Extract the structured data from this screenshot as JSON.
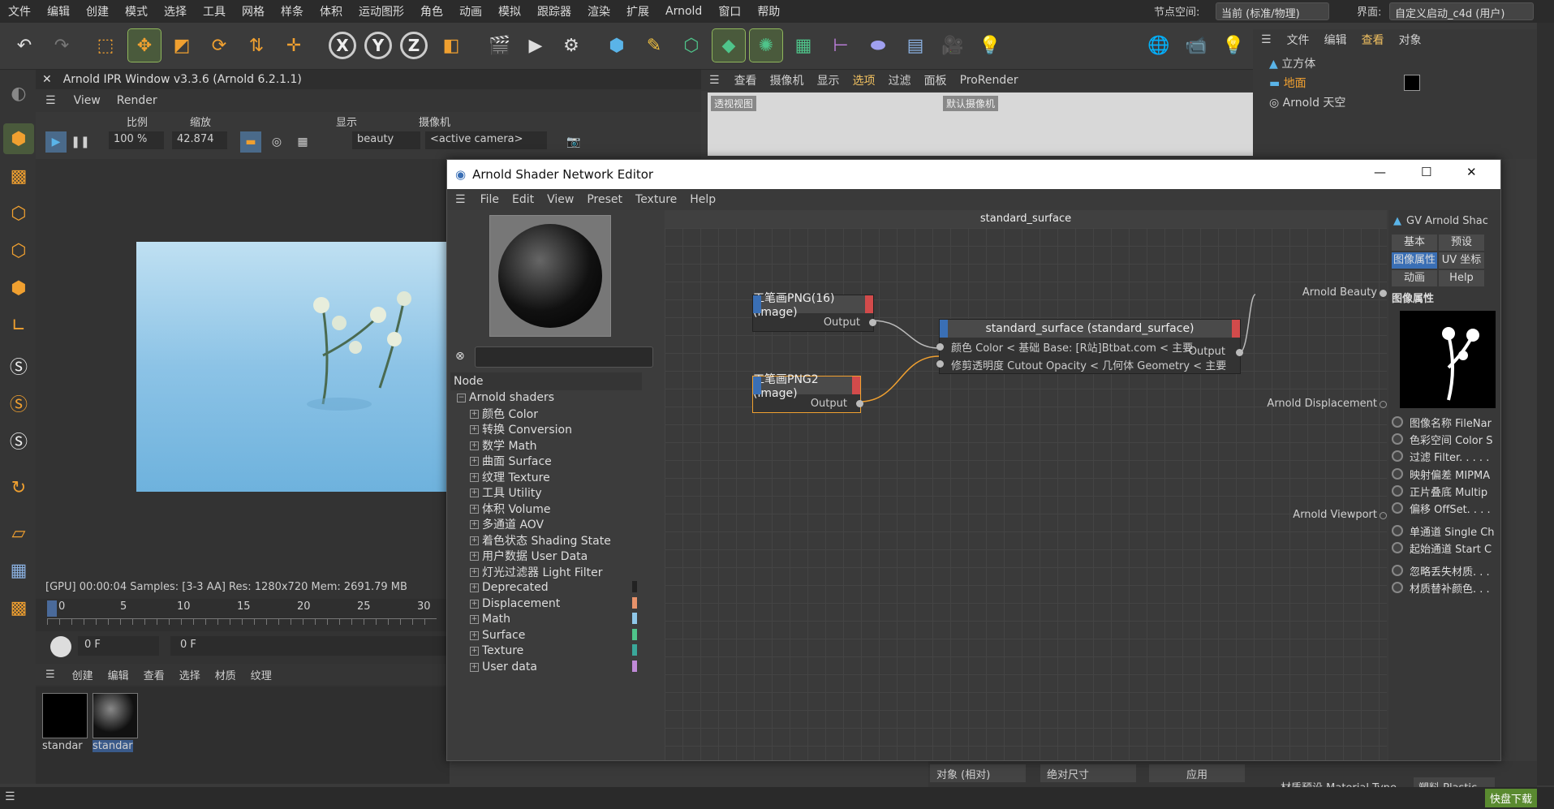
{
  "menubar": {
    "items": [
      "文件",
      "编辑",
      "创建",
      "模式",
      "选择",
      "工具",
      "网格",
      "样条",
      "体积",
      "运动图形",
      "角色",
      "动画",
      "模拟",
      "跟踪器",
      "渲染",
      "扩展",
      "Arnold",
      "窗口",
      "帮助"
    ],
    "node_space_label": "节点空间:",
    "node_space_value": "当前 (标准/物理)",
    "layout_label": "界面:",
    "layout_value": "自定义启动_c4d (用户)"
  },
  "toolbar": {
    "x": "X",
    "y": "Y",
    "z": "Z"
  },
  "ipr": {
    "title": "Arnold IPR Window v3.3.6 (Arnold 6.2.1.1)",
    "menu": [
      "View",
      "Render"
    ],
    "scale_label": "比例",
    "scale_value": "100 %",
    "zoom_label": "缩放",
    "zoom_value": "42.874",
    "display_label": "显示",
    "display_value": "beauty",
    "camera_label": "摄像机",
    "camera_value": "<active camera>",
    "status": "[GPU] 00:00:04  Samples: [3-3 AA]  Res: 1280x720  Mem: 2691.79 MB"
  },
  "timeline": {
    "ticks": [
      "0",
      "5",
      "10",
      "15",
      "20",
      "25",
      "30"
    ],
    "frame_a": "0 F",
    "frame_b": "0 F"
  },
  "material_mgr": {
    "menu": [
      "创建",
      "编辑",
      "查看",
      "选择",
      "材质",
      "纹理"
    ],
    "materials": [
      "standar",
      "standar"
    ]
  },
  "viewport": {
    "menu": [
      "查看",
      "摄像机",
      "显示",
      "选项",
      "过滤",
      "面板",
      "ProRender"
    ],
    "label_left": "透视视图",
    "label_cam": "默认摄像机"
  },
  "objmgr": {
    "menu": [
      "文件",
      "编辑",
      "查看",
      "对象"
    ],
    "objects": [
      "立方体",
      "地面",
      "Arnold 天空"
    ]
  },
  "editor": {
    "title": "Arnold Shader Network Editor",
    "menu": [
      "File",
      "Edit",
      "View",
      "Preset",
      "Texture",
      "Help"
    ],
    "tree_header": "Node",
    "tree_root": "Arnold shaders",
    "tree_items": [
      "颜色 Color",
      "转换 Conversion",
      "数学 Math",
      "曲面 Surface",
      "纹理 Texture",
      "工具 Utility",
      "体积 Volume",
      "多通道 AOV",
      "着色状态 Shading State",
      "用户数据 User Data",
      "灯光过滤器 Light Filter",
      "Deprecated",
      "Displacement",
      "Math",
      "Surface",
      "Texture",
      "User data"
    ],
    "tree_colors": [
      "#222222",
      "#e8926a",
      "#8fc7e8",
      "#4fc48a",
      "#3aa89a",
      "#c08ad8"
    ],
    "graph_title": "standard_surface",
    "node1": {
      "title": "工笔画PNG(16) (image)",
      "out": "Output"
    },
    "node2": {
      "title": "工笔画PNG2 (image)",
      "out": "Output"
    },
    "node3": {
      "title": "standard_surface (standard_surface)",
      "in1": "颜色 Color < 基础 Base: [R站]Btbat.com < 主要",
      "in2": "修剪透明度 Cutout Opacity < 几何体 Geometry < 主要",
      "out": "Output"
    },
    "outputs": [
      "Arnold Beauty",
      "Arnold Displacement",
      "Arnold Viewport"
    ]
  },
  "attr": {
    "title": "GV Arnold Shac",
    "tabs": [
      "基本",
      "预设",
      "图像属性",
      "UV 坐标",
      "动画",
      "Help"
    ],
    "section": "图像属性",
    "params": [
      "图像名称 FileNar",
      "色彩空间 Color S",
      "过滤 Filter. . . . .",
      "映射偏差 MIPMA",
      "正片叠底 Multip",
      "偏移 OffSet. . . .",
      "单通道 Single Ch",
      "起始通道 Start C",
      "忽略丢失材质. . .",
      "材质替补颜色. . ."
    ]
  },
  "attr_bottom": {
    "coord": "对象 (相对)",
    "size": "绝对尺寸",
    "apply": "应用",
    "mat_type_label": "材质预设 Material Type",
    "mat_type_value": "塑料 Plastic"
  },
  "watermark": "快盘下载"
}
